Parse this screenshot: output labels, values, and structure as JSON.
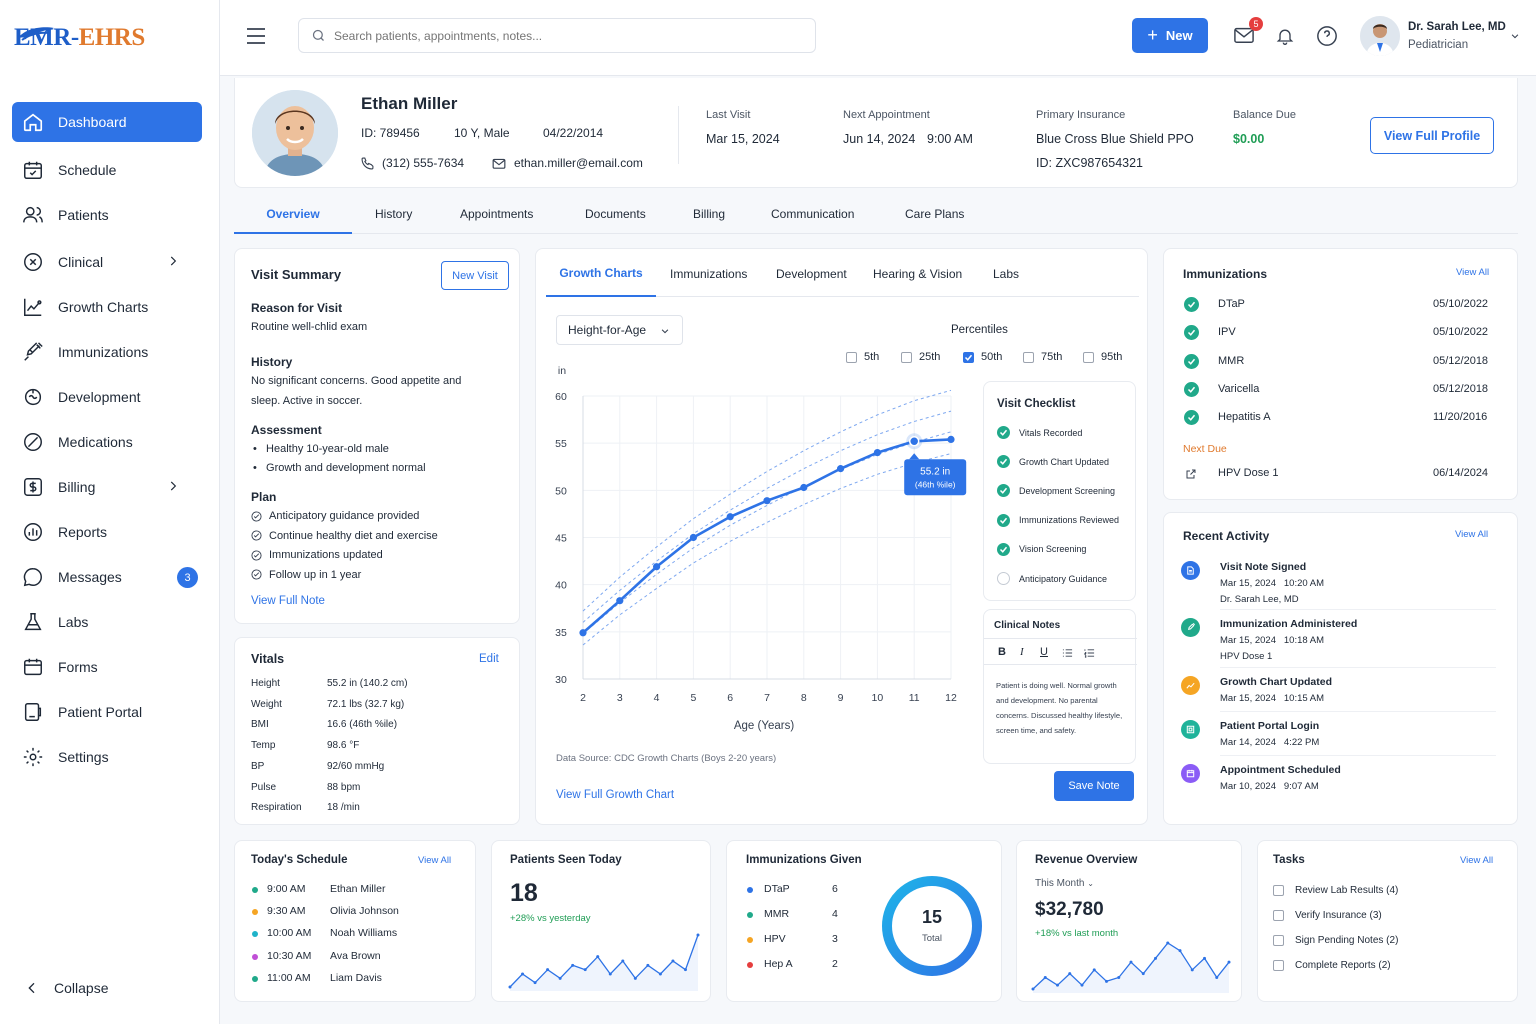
{
  "brand": {
    "logo_left": "EMR-",
    "logo_right": "EHRS"
  },
  "sidebar": {
    "items": [
      {
        "label": "Dashboard"
      },
      {
        "label": "Schedule"
      },
      {
        "label": "Patients"
      },
      {
        "label": "Clinical"
      },
      {
        "label": "Growth Charts"
      },
      {
        "label": "Immunizations"
      },
      {
        "label": "Development"
      },
      {
        "label": "Medications"
      },
      {
        "label": "Billing"
      },
      {
        "label": "Reports"
      },
      {
        "label": "Messages",
        "badge": "3"
      },
      {
        "label": "Labs"
      },
      {
        "label": "Forms"
      },
      {
        "label": "Patient Portal"
      },
      {
        "label": "Settings"
      }
    ],
    "collapse": "Collapse"
  },
  "topbar": {
    "search_placeholder": "Search patients, appointments, notes...",
    "new_label": "New",
    "mail_badge": "5",
    "user_name": "Dr. Sarah Lee, MD",
    "user_role": "Pediatrician"
  },
  "patient": {
    "name": "Ethan Miller",
    "id": "ID: 789456",
    "age_sex": "10 Y, Male",
    "dob": "04/22/2014",
    "phone": "(312) 555-7634",
    "email": "ethan.miller@email.com",
    "last_visit_label": "Last Visit",
    "last_visit": "Mar 15, 2024",
    "next_appt_label": "Next Appointment",
    "next_appt_date": "Jun 14, 2024",
    "next_appt_time": "9:00 AM",
    "insurance_label": "Primary Insurance",
    "insurance": "Blue Cross Blue Shield PPO",
    "insurance_id": "ID: ZXC987654321",
    "balance_label": "Balance Due",
    "balance": "$0.00",
    "view_profile": "View Full Profile"
  },
  "tabs": [
    "Overview",
    "History",
    "Appointments",
    "Documents",
    "Billing",
    "Communication",
    "Care Plans"
  ],
  "visit_summary": {
    "title": "Visit Summary",
    "new_visit": "New Visit",
    "reason_h": "Reason for Visit",
    "reason": "Routine well-chlid exam",
    "history_h": "History",
    "history_1": "No significant concerns. Good appetite and",
    "history_2": "sleep. Active in soccer.",
    "assessment_h": "Assessment",
    "assessment": [
      "Healthy 10-year-old male",
      "Growth and development normal"
    ],
    "plan_h": "Plan",
    "plan": [
      "Anticipatory guidance provided",
      "Continue healthy diet and exercise",
      "Immunizations updated",
      "Follow up in 1 year"
    ],
    "view_note": "View Full Note"
  },
  "vitals": {
    "title": "Vitals",
    "edit": "Edit",
    "rows": [
      {
        "k": "Height",
        "v": "55.2 in (140.2 cm)"
      },
      {
        "k": "Weight",
        "v": "72.1 lbs (32.7 kg)"
      },
      {
        "k": "BMI",
        "v": "16.6 (46th %ile)"
      },
      {
        "k": "Temp",
        "v": "98.6 °F"
      },
      {
        "k": "BP",
        "v": "92/60 mmHg"
      },
      {
        "k": "Pulse",
        "v": "88 bpm"
      },
      {
        "k": "Respiration",
        "v": "18 /min"
      }
    ]
  },
  "growth": {
    "tabs": [
      "Growth Charts",
      "Immunizations",
      "Development",
      "Hearing & Vision",
      "Labs"
    ],
    "select": "Height-for-Age",
    "percentiles_label": "Percentiles",
    "percentiles": [
      {
        "label": "5th",
        "on": false
      },
      {
        "label": "25th",
        "on": false
      },
      {
        "label": "50th",
        "on": true
      },
      {
        "label": "75th",
        "on": false
      },
      {
        "label": "95th",
        "on": false
      }
    ],
    "source": "Data Source: CDC Growth Charts (Boys 2-20 years)",
    "view_full": "View Full Growth Chart",
    "tooltip_1": "55.2 in",
    "tooltip_2": "(46th %ile)"
  },
  "chart_data": {
    "type": "line",
    "xlabel": "Age (Years)",
    "ylabel": "in",
    "xlim": [
      2,
      12
    ],
    "ylim": [
      30,
      60
    ],
    "x_ticks": [
      2,
      3,
      4,
      5,
      6,
      7,
      8,
      9,
      10,
      11,
      12
    ],
    "y_ticks": [
      30,
      35,
      40,
      45,
      50,
      55,
      60
    ],
    "series": [
      {
        "x": [
          2,
          3,
          4,
          5,
          6,
          7,
          8,
          9,
          10,
          11,
          12
        ],
        "values": [
          34.9,
          38.3,
          41.9,
          45.0,
          47.2,
          48.9,
          50.3,
          52.3,
          54.0,
          55.2,
          55.4
        ]
      }
    ],
    "percentile_curves": [
      {
        "values": [
          33.6,
          36.8,
          39.6,
          42.3,
          44.6,
          46.6,
          48.5,
          50.2,
          51.7,
          52.9,
          53.9
        ]
      },
      {
        "values": [
          34.8,
          38.1,
          41.1,
          43.9,
          46.3,
          48.4,
          50.4,
          52.2,
          53.8,
          55.1,
          56.2
        ]
      },
      {
        "values": [
          36.0,
          39.4,
          42.5,
          45.4,
          47.9,
          50.2,
          52.3,
          54.2,
          55.9,
          57.3,
          58.4
        ]
      },
      {
        "values": [
          37.2,
          40.8,
          44.0,
          47.0,
          49.6,
          52.0,
          54.2,
          56.2,
          58.0,
          59.5,
          60.6
        ]
      }
    ],
    "highlight": {
      "x": 11,
      "y": 55.2
    }
  },
  "checklist": {
    "title": "Visit Checklist",
    "items": [
      {
        "label": "Vitals Recorded",
        "done": true
      },
      {
        "label": "Growth Chart Updated",
        "done": true
      },
      {
        "label": "Development Screening",
        "done": true
      },
      {
        "label": "Immunizations Reviewed",
        "done": true
      },
      {
        "label": "Vision Screening",
        "done": true
      },
      {
        "label": "Anticipatory Guidance",
        "done": false
      }
    ]
  },
  "notes": {
    "title": "Clinical Notes",
    "text": "Patient is doing well. Normal growth and development. No parental concerns. Discussed healthy lifestyle, screen time, and safety.",
    "save": "Save Note"
  },
  "immunizations": {
    "title": "Immunizations",
    "view_all": "View All",
    "items": [
      {
        "name": "DTaP",
        "date": "05/10/2022"
      },
      {
        "name": "IPV",
        "date": "05/10/2022"
      },
      {
        "name": "MMR",
        "date": "05/12/2018"
      },
      {
        "name": "Varicella",
        "date": "05/12/2018"
      },
      {
        "name": "Hepatitis A",
        "date": "11/20/2016"
      }
    ],
    "next_due_label": "Next Due",
    "next_due": {
      "name": "HPV Dose 1",
      "date": "06/14/2024"
    }
  },
  "activity": {
    "title": "Recent Activity",
    "view_all": "View All",
    "items": [
      {
        "title": "Visit Note Signed",
        "time": "Mar 15, 2024   10:20 AM",
        "sub": "Dr. Sarah Lee, MD",
        "color": "#2e73e6"
      },
      {
        "title": "Immunization Administered",
        "time": "Mar 15, 2024   10:18 AM",
        "sub": "HPV Dose 1",
        "color": "#20a98a"
      },
      {
        "title": "Growth Chart Updated",
        "time": "Mar 15, 2024   10:15 AM",
        "sub": "",
        "color": "#f5a524"
      },
      {
        "title": "Patient Portal Login",
        "time": "Mar 14, 2024   4:22 PM",
        "sub": "",
        "color": "#1fb39a"
      },
      {
        "title": "Appointment Scheduled",
        "time": "Mar 10, 2024   9:07 AM",
        "sub": "",
        "color": "#8b5cf6"
      }
    ]
  },
  "schedule": {
    "title": "Today's Schedule",
    "view_all": "View All",
    "items": [
      {
        "time": "9:00 AM",
        "name": "Ethan Miller",
        "color": "#20a98a"
      },
      {
        "time": "9:30 AM",
        "name": "Olivia Johnson",
        "color": "#f5a524"
      },
      {
        "time": "10:00 AM",
        "name": "Noah Williams",
        "color": "#1fb3c9"
      },
      {
        "time": "10:30 AM",
        "name": "Ava Brown",
        "color": "#c04fd6"
      },
      {
        "time": "11:00 AM",
        "name": "Liam Davis",
        "color": "#20a98a"
      }
    ]
  },
  "seen": {
    "title": "Patients Seen Today",
    "value": "18",
    "delta": "+28% vs yesterday",
    "spark": [
      3,
      6,
      4,
      7,
      5,
      8,
      7,
      10,
      6,
      9,
      5,
      8,
      6,
      9,
      7,
      15
    ]
  },
  "imm_given": {
    "title": "Immunizations Given",
    "items": [
      {
        "name": "DTaP",
        "n": "6",
        "color": "#2e73e6"
      },
      {
        "name": "MMR",
        "n": "4",
        "color": "#20a98a"
      },
      {
        "name": "HPV",
        "n": "3",
        "color": "#f5a524"
      },
      {
        "name": "Hep A",
        "n": "2",
        "color": "#e53e3e"
      }
    ],
    "total": "15",
    "total_label": "Total"
  },
  "revenue": {
    "title": "Revenue Overview",
    "period": "This Month",
    "value": "$32,780",
    "delta": "+18% vs last month",
    "spark": [
      4,
      7,
      5,
      8,
      5,
      9,
      6,
      7,
      11,
      8,
      12,
      16,
      14,
      9,
      12,
      7,
      11
    ]
  },
  "tasks": {
    "title": "Tasks",
    "view_all": "View All",
    "items": [
      "Review Lab Results (4)",
      "Verify Insurance (3)",
      "Sign Pending Notes (2)",
      "Complete Reports (2)"
    ]
  }
}
